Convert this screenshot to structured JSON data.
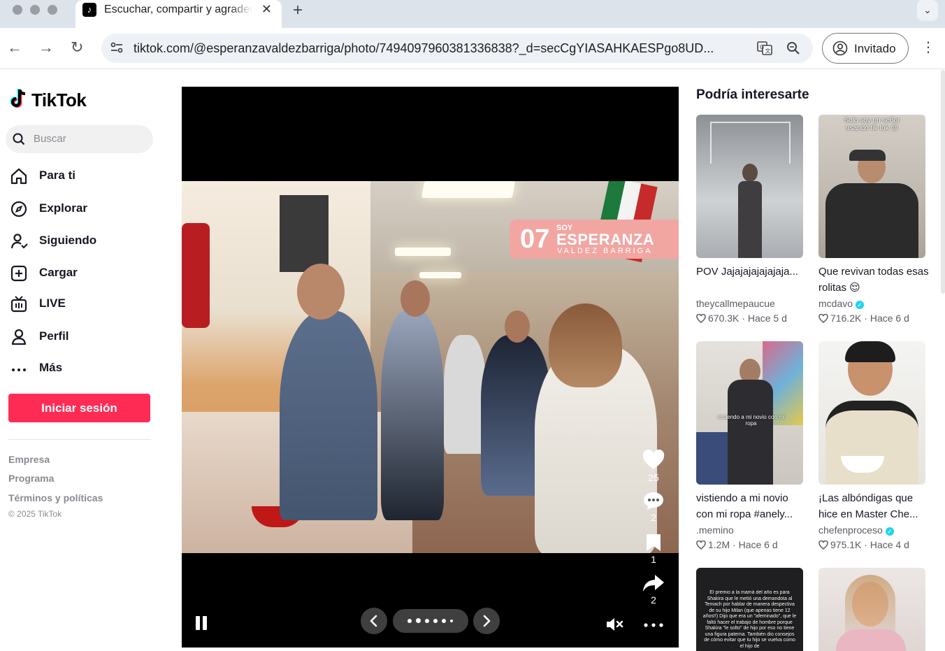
{
  "browser": {
    "tab_title": "Escuchar, compartir y agradecer",
    "tab_close": "✕",
    "new_tab": "+",
    "url": "tiktok.com/@esperanzavaldezbarriga/photo/7494097960381336838?_d=secCgYIASAHKAESPgo8UD...",
    "profile_label": "Invitado",
    "back": "←",
    "forward": "→",
    "reload": "↻",
    "menu": "⋮",
    "tab_dropdown": "⌄"
  },
  "sidebar": {
    "logo": "TikTok",
    "search_placeholder": "Buscar",
    "nav": [
      {
        "label": "Para ti",
        "icon": "home-icon"
      },
      {
        "label": "Explorar",
        "icon": "compass-icon"
      },
      {
        "label": "Siguiendo",
        "icon": "following-icon"
      },
      {
        "label": "Cargar",
        "icon": "upload-icon"
      },
      {
        "label": "LIVE",
        "icon": "live-icon"
      },
      {
        "label": "Perfil",
        "icon": "profile-icon"
      },
      {
        "label": "Más",
        "icon": "more-icon"
      }
    ],
    "login": "Iniciar sesión",
    "footer": [
      "Empresa",
      "Programa",
      "Términos y políticas"
    ],
    "copyright": "© 2025 TikTok"
  },
  "player": {
    "banner": {
      "number": "07",
      "soy": "SOY",
      "name": "ESPERANZA",
      "sub": "VALDEZ BARRIGA"
    },
    "likes": "25",
    "comments": "2",
    "saves": "1",
    "shares": "2",
    "slide_count": 6,
    "active_slide": 1
  },
  "recommendations": {
    "title": "Podría interesarte",
    "items": [
      {
        "title": "POV Jajajajajajajaja...",
        "author": "theycallmepaucue",
        "verified": false,
        "likes": "670.3K",
        "age": "Hace 5 d",
        "caption": ""
      },
      {
        "title": "Que revivan todas esas rolitas 😌",
        "author": "mcdavo",
        "verified": true,
        "likes": "716.2K",
        "age": "Hace 6 d",
        "caption": "Solo soy un señor usando tik tok 😉"
      },
      {
        "title": "vistiendo a mi novio con mi ropa #anely...",
        "author": ".memino",
        "verified": false,
        "likes": "1.2M",
        "age": "Hace 6 d",
        "caption": "vistiendo a mi novio con mi ropa"
      },
      {
        "title": "¡Las albóndigas que hice en Master Che...",
        "author": "chefenproceso",
        "verified": true,
        "likes": "975.1K",
        "age": "Hace 4 d",
        "caption": ""
      },
      {
        "title": "",
        "author": "",
        "verified": false,
        "likes": "",
        "age": "",
        "caption": "El premio a la mamá del año es para Shakira que le metió una demandota al Temach por hablar de manera despectiva de su hijo Milan (que apenas tiene 12 años!!) Dijo que era un \"afeminado\", que le faltó hacer el trabajo de hombre porque Shakira \"le solto\" de hijo por eso no tiene una figura paterna. También dio consejos de cómo evitar que tu hijo se vuelva como el hijo de"
      },
      {
        "title": "",
        "author": "",
        "verified": false,
        "likes": "",
        "age": "",
        "caption": ""
      }
    ]
  }
}
